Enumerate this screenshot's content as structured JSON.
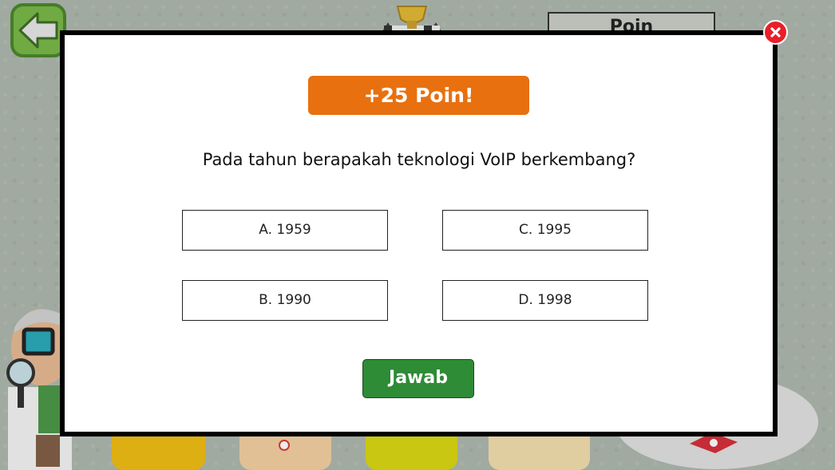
{
  "hud": {
    "back_icon": "arrow-left-icon",
    "score_label": "Poin",
    "trophy_icon": "trophy-icon"
  },
  "modal": {
    "close_icon": "close-icon",
    "points_awarded": "+25 Poin!",
    "question": "Pada tahun berapakah teknologi VoIP berkembang?",
    "options": [
      {
        "label": "A. 1959"
      },
      {
        "label": "C. 1995"
      },
      {
        "label": "B. 1990"
      },
      {
        "label": "D. 1998"
      }
    ],
    "submit_label": "Jawab"
  },
  "colors": {
    "badge": "#e8700f",
    "submit": "#2e8b36",
    "close": "#e8202a",
    "back": "#6fb23a"
  }
}
